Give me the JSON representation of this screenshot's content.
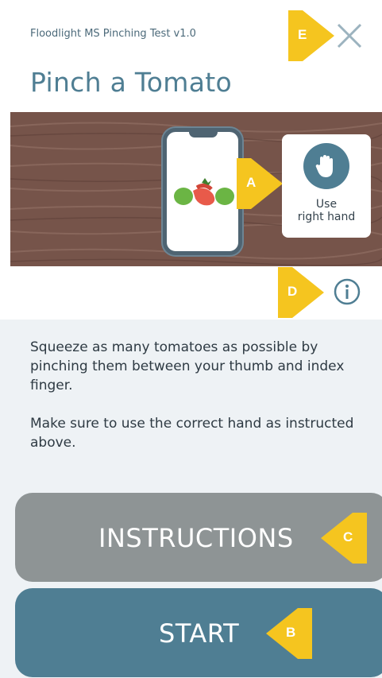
{
  "header": {
    "app_title": "Floodlight MS Pinching Test v1.0",
    "page_title": "Pinch a Tomato",
    "close_icon": "close-icon"
  },
  "scene": {
    "hand_instruction_line1": "Use",
    "hand_instruction_line2": "right hand",
    "hand_icon": "hand-icon"
  },
  "markers": {
    "a": "A",
    "b": "B",
    "c": "C",
    "d": "D",
    "e": "E"
  },
  "info_icon": "info-icon",
  "description": {
    "paragraph1": "Squeeze as many tomatoes as possible by pinching them between your thumb and index finger.",
    "paragraph2": "Make sure to use the correct hand as instructed above."
  },
  "buttons": {
    "instructions_label": "INSTRUCTIONS",
    "start_label": "START"
  },
  "colors": {
    "accent": "#4f7e93",
    "marker_yellow": "#f5c51f",
    "secondary_button": "#8e9495",
    "wood": "#76544a",
    "panel": "#eef2f5"
  }
}
